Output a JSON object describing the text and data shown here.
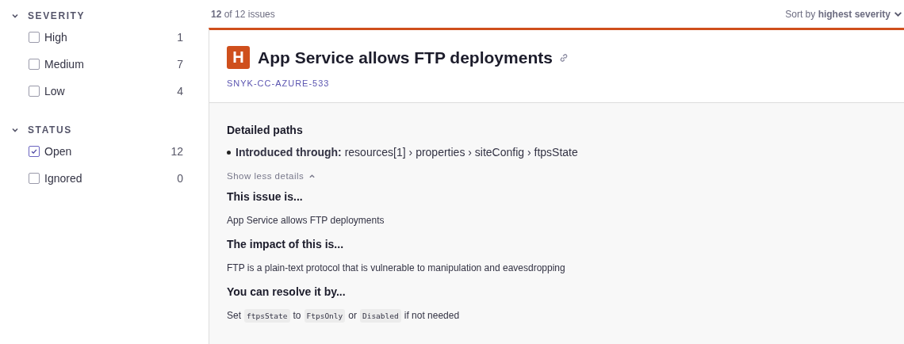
{
  "filters": [
    {
      "title": "SEVERITY",
      "expanded": true,
      "items": [
        {
          "label": "High",
          "count": "1",
          "checked": false
        },
        {
          "label": "Medium",
          "count": "7",
          "checked": false
        },
        {
          "label": "Low",
          "count": "4",
          "checked": false
        }
      ]
    },
    {
      "title": "STATUS",
      "expanded": true,
      "items": [
        {
          "label": "Open",
          "count": "12",
          "checked": true
        },
        {
          "label": "Ignored",
          "count": "0",
          "checked": false
        }
      ]
    }
  ],
  "results": {
    "count": "**12** of 12 issues",
    "sort": "Sort by **highest severity**"
  },
  "issue": {
    "kind": "high",
    "badge": "H",
    "title": "App Service allows FTP deployments",
    "id": "SNYK-CC-AZURE-533",
    "paths_heading": "Detailed paths",
    "paths": [
      "**Introduced through:** resources[1] › properties › siteConfig › ftpsState"
    ],
    "toggle": "Show less details",
    "sections": [
      {
        "heading": "This issue is...",
        "body": [
          {
            "kind": "text",
            "text": "App Service allows FTP deployments"
          }
        ]
      },
      {
        "heading": "The impact of this is...",
        "body": [
          {
            "kind": "text",
            "text": "FTP is a plain-text protocol that is vulnerable to manipulation and eavesdropping"
          }
        ]
      },
      {
        "heading": "You can resolve it by...",
        "body": [
          {
            "kind": "text",
            "text": "Set"
          },
          {
            "kind": "code",
            "text": "ftpsState"
          },
          {
            "kind": "text",
            "text": "to"
          },
          {
            "kind": "code",
            "text": "FtpsOnly"
          },
          {
            "kind": "text",
            "text": "or"
          },
          {
            "kind": "code",
            "text": "Disabled"
          },
          {
            "kind": "text",
            "text": "if not needed"
          }
        ]
      }
    ]
  }
}
